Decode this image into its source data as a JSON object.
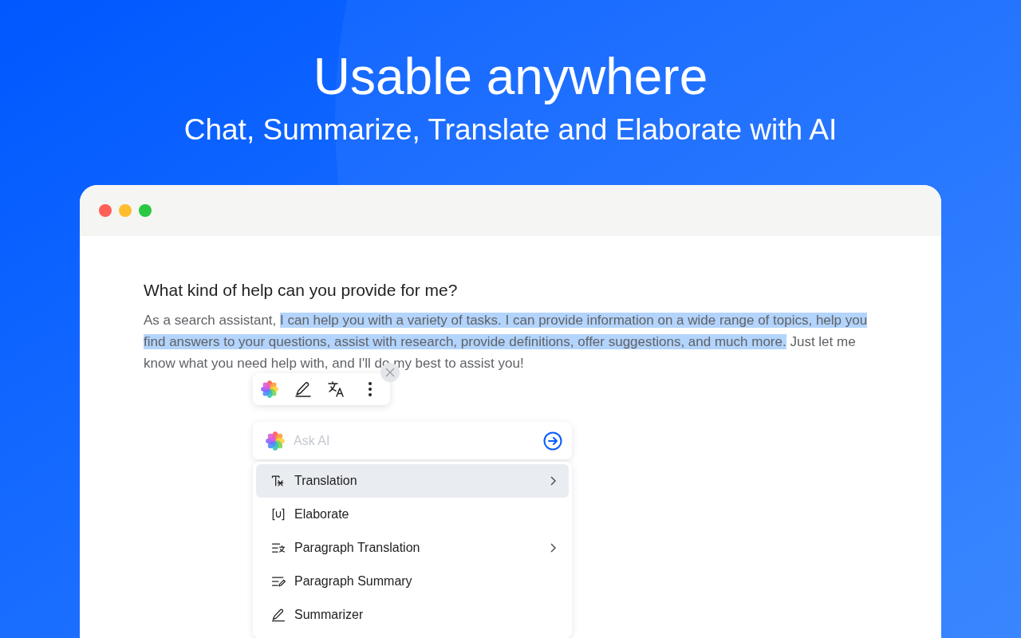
{
  "hero": {
    "title": "Usable anywhere",
    "subtitle": "Chat, Summarize, Translate and Elaborate with AI"
  },
  "document": {
    "heading": "What kind of help can you provide for me?",
    "paragraph": [
      {
        "text": "As a search assistant, ",
        "selected": false
      },
      {
        "text": "I can help you with a variety of tasks. I can provide information on a wide range of topics, help you find answers to your questions, assist with research, provide definitions, offer suggestions, and much more.",
        "selected": true
      },
      {
        "text": " Just let me know what you need help with, and I'll do my best to assist you!",
        "selected": false
      }
    ]
  },
  "ask_ai": {
    "placeholder": "Ask AI"
  },
  "menu": [
    {
      "label": "Translation",
      "selected": true,
      "submenu": true
    },
    {
      "label": "Elaborate",
      "selected": false,
      "submenu": false
    },
    {
      "label": "Paragraph Translation",
      "selected": false,
      "submenu": true
    },
    {
      "label": "Paragraph Summary",
      "selected": false,
      "submenu": false
    },
    {
      "label": "Summarizer",
      "selected": false,
      "submenu": false
    }
  ]
}
